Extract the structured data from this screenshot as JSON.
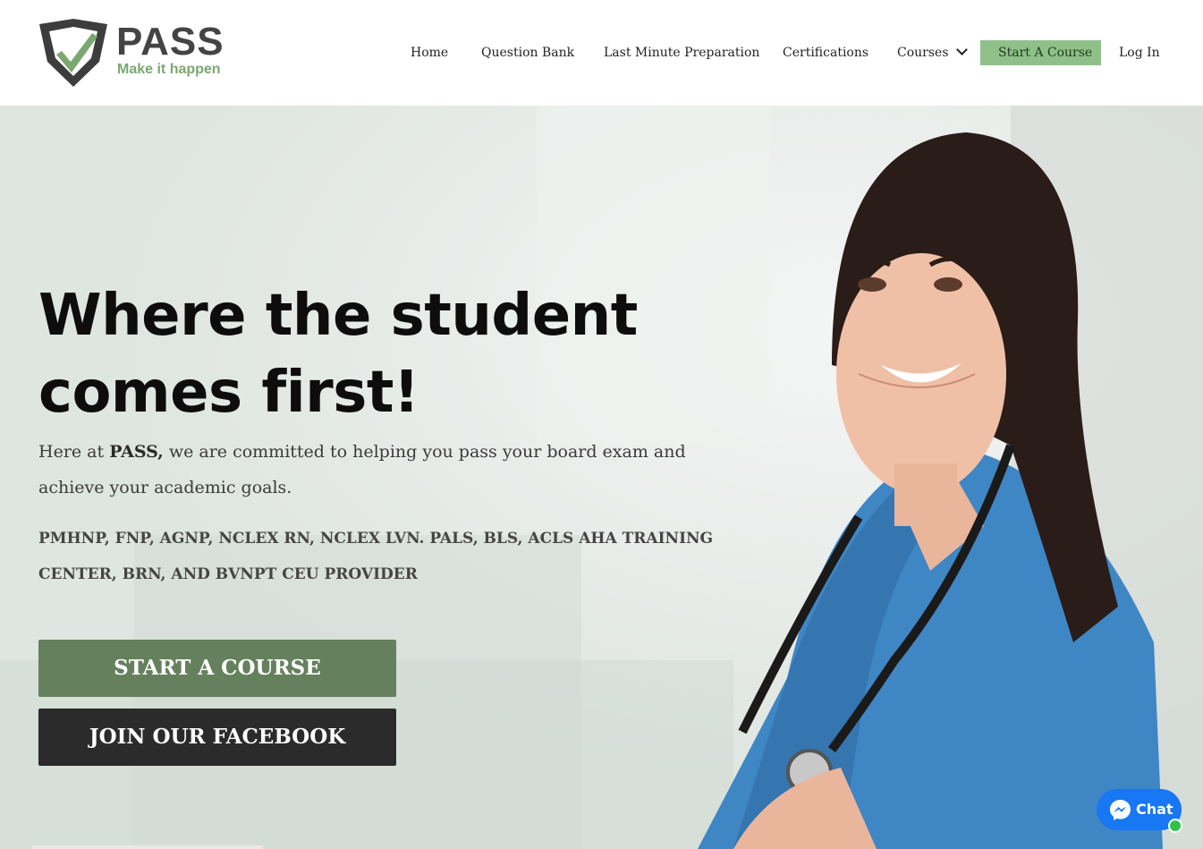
{
  "brand": {
    "name": "PASS",
    "tagline": "Make it happen",
    "colors": {
      "primary_green": "#65805d",
      "light_green": "#8fc08a",
      "logo_gray": "#444444",
      "dark": "#2b2b2b",
      "chat_blue": "#1877f2"
    }
  },
  "nav": {
    "items": [
      {
        "label": "Home"
      },
      {
        "label": "Question Bank"
      },
      {
        "label": "Last Minute Preparation"
      },
      {
        "label": "Certifications"
      },
      {
        "label": "Courses",
        "icon": "chevron-down-icon"
      },
      {
        "label": "Start A Course"
      },
      {
        "label": "Log In"
      }
    ]
  },
  "hero": {
    "title_line1": "Where the student",
    "title_line2": "comes first!",
    "desc_prefix": "Here at ",
    "desc_brand": "PASS,",
    "desc_suffix": " we are committed to helping you pass your board exam and achieve your academic goals.",
    "certifications": "PMHNP, FNP, AGNP, NCLEX RN, NCLEX LVN. PALS, BLS, ACLS AHA TRAINING CENTER, BRN, AND BVNPT CEU PROVIDER",
    "buttons": {
      "start_course": "START A COURSE",
      "join_facebook": "JOIN OUR FACEBOOK"
    }
  },
  "chat": {
    "label": "Chat",
    "icon": "messenger-icon",
    "status": "online"
  }
}
